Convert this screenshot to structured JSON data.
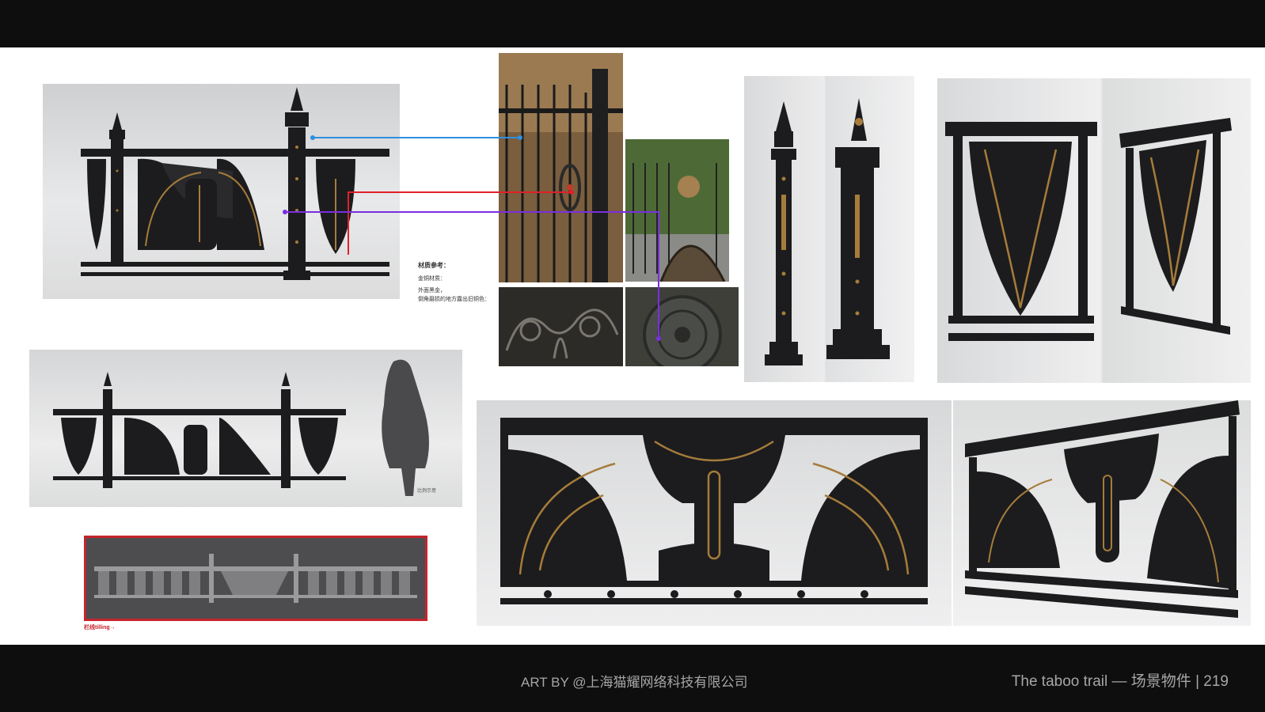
{
  "footer": {
    "credit": "ART BY @上海猫耀网络科技有限公司",
    "right": "The taboo trail — 场景物件  |  219"
  },
  "notes": {
    "heading": "材质参考：",
    "line1": "金铜材质：",
    "line2": "外面黑金，",
    "line3": "倒角磨损的地方露出旧铜色："
  },
  "scale_label": "比例示意",
  "tiling_label": "栏线tilling→",
  "colors": {
    "bars": "#0e0e0f",
    "footer_text": "#a6a6a6",
    "iron": "#1c1c1e",
    "bronze": "#a67c3a",
    "connector_blue": "#2f8fe0",
    "connector_red": "#e0202a",
    "connector_purple": "#7a2ee0",
    "tiling_border": "#c4242c"
  }
}
